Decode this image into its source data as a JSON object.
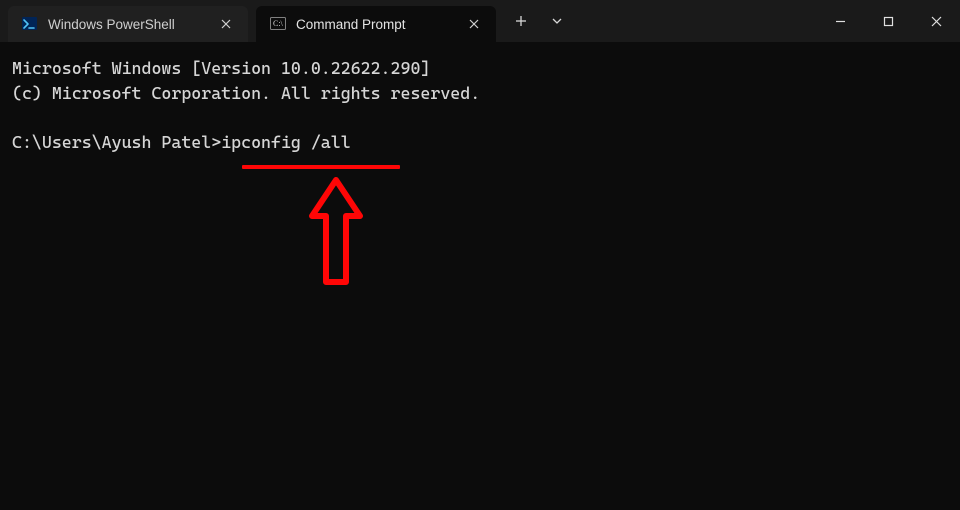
{
  "tabs": [
    {
      "label": "Windows PowerShell",
      "active": false
    },
    {
      "label": "Command Prompt",
      "active": true
    }
  ],
  "terminal": {
    "line1": "Microsoft Windows [Version 10.0.22622.290]",
    "line2": "(c) Microsoft Corporation. All rights reserved.",
    "blank": "",
    "prompt": "C:\\Users\\Ayush Patel>",
    "command": "ipconfig /all"
  },
  "annotation": {
    "underline_color": "#ff0606",
    "arrow_color": "#ff0606"
  }
}
